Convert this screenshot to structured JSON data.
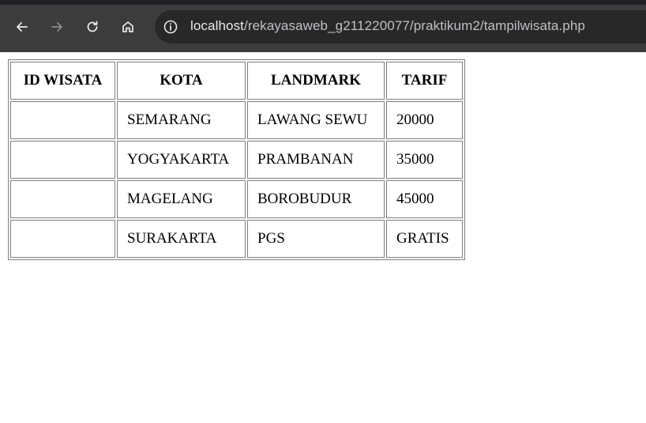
{
  "browser": {
    "icons": {
      "back": "arrow-left-icon",
      "forward": "arrow-right-icon",
      "reload": "reload-icon",
      "home": "home-icon",
      "site_info": "info-icon"
    },
    "url_host": "localhost",
    "url_path": "/rekayasaweb_g211220077/praktikum2/tampilwisata.php"
  },
  "table": {
    "headers": [
      "ID WISATA",
      "KOTA",
      "LANDMARK",
      "TARIF"
    ],
    "rows": [
      [
        "",
        "SEMARANG",
        "LAWANG SEWU",
        "20000"
      ],
      [
        "",
        "YOGYAKARTA",
        "PRAMBANAN",
        "35000"
      ],
      [
        "",
        "MAGELANG",
        "BOROBUDUR",
        "45000"
      ],
      [
        "",
        "SURAKARTA",
        "PGS",
        "GRATIS"
      ]
    ]
  },
  "colors": {
    "toolbar_bg": "#3c3c3c",
    "omnibox_bg": "#282828",
    "table_border": "#808080"
  }
}
